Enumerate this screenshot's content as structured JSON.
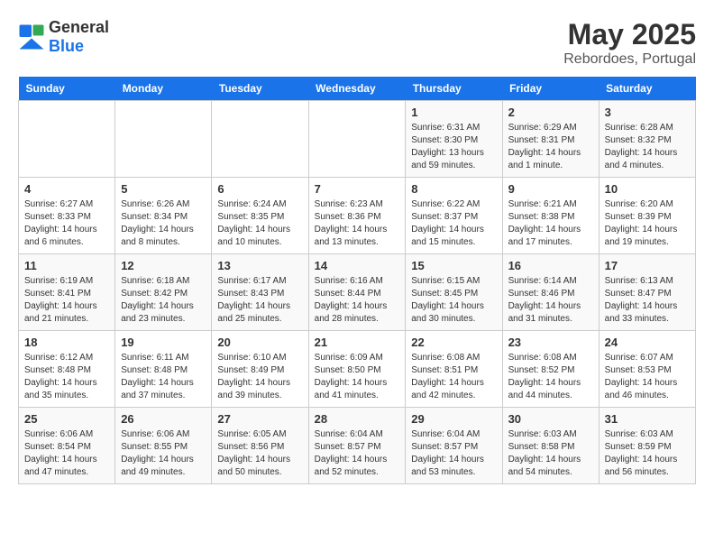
{
  "header": {
    "logo_general": "General",
    "logo_blue": "Blue",
    "main_title": "May 2025",
    "subtitle": "Rebordoes, Portugal"
  },
  "days_of_week": [
    "Sunday",
    "Monday",
    "Tuesday",
    "Wednesday",
    "Thursday",
    "Friday",
    "Saturday"
  ],
  "weeks": [
    [
      {
        "day": "",
        "info": ""
      },
      {
        "day": "",
        "info": ""
      },
      {
        "day": "",
        "info": ""
      },
      {
        "day": "",
        "info": ""
      },
      {
        "day": "1",
        "info": "Sunrise: 6:31 AM\nSunset: 8:30 PM\nDaylight: 13 hours and 59 minutes."
      },
      {
        "day": "2",
        "info": "Sunrise: 6:29 AM\nSunset: 8:31 PM\nDaylight: 14 hours and 1 minute."
      },
      {
        "day": "3",
        "info": "Sunrise: 6:28 AM\nSunset: 8:32 PM\nDaylight: 14 hours and 4 minutes."
      }
    ],
    [
      {
        "day": "4",
        "info": "Sunrise: 6:27 AM\nSunset: 8:33 PM\nDaylight: 14 hours and 6 minutes."
      },
      {
        "day": "5",
        "info": "Sunrise: 6:26 AM\nSunset: 8:34 PM\nDaylight: 14 hours and 8 minutes."
      },
      {
        "day": "6",
        "info": "Sunrise: 6:24 AM\nSunset: 8:35 PM\nDaylight: 14 hours and 10 minutes."
      },
      {
        "day": "7",
        "info": "Sunrise: 6:23 AM\nSunset: 8:36 PM\nDaylight: 14 hours and 13 minutes."
      },
      {
        "day": "8",
        "info": "Sunrise: 6:22 AM\nSunset: 8:37 PM\nDaylight: 14 hours and 15 minutes."
      },
      {
        "day": "9",
        "info": "Sunrise: 6:21 AM\nSunset: 8:38 PM\nDaylight: 14 hours and 17 minutes."
      },
      {
        "day": "10",
        "info": "Sunrise: 6:20 AM\nSunset: 8:39 PM\nDaylight: 14 hours and 19 minutes."
      }
    ],
    [
      {
        "day": "11",
        "info": "Sunrise: 6:19 AM\nSunset: 8:41 PM\nDaylight: 14 hours and 21 minutes."
      },
      {
        "day": "12",
        "info": "Sunrise: 6:18 AM\nSunset: 8:42 PM\nDaylight: 14 hours and 23 minutes."
      },
      {
        "day": "13",
        "info": "Sunrise: 6:17 AM\nSunset: 8:43 PM\nDaylight: 14 hours and 25 minutes."
      },
      {
        "day": "14",
        "info": "Sunrise: 6:16 AM\nSunset: 8:44 PM\nDaylight: 14 hours and 28 minutes."
      },
      {
        "day": "15",
        "info": "Sunrise: 6:15 AM\nSunset: 8:45 PM\nDaylight: 14 hours and 30 minutes."
      },
      {
        "day": "16",
        "info": "Sunrise: 6:14 AM\nSunset: 8:46 PM\nDaylight: 14 hours and 31 minutes."
      },
      {
        "day": "17",
        "info": "Sunrise: 6:13 AM\nSunset: 8:47 PM\nDaylight: 14 hours and 33 minutes."
      }
    ],
    [
      {
        "day": "18",
        "info": "Sunrise: 6:12 AM\nSunset: 8:48 PM\nDaylight: 14 hours and 35 minutes."
      },
      {
        "day": "19",
        "info": "Sunrise: 6:11 AM\nSunset: 8:48 PM\nDaylight: 14 hours and 37 minutes."
      },
      {
        "day": "20",
        "info": "Sunrise: 6:10 AM\nSunset: 8:49 PM\nDaylight: 14 hours and 39 minutes."
      },
      {
        "day": "21",
        "info": "Sunrise: 6:09 AM\nSunset: 8:50 PM\nDaylight: 14 hours and 41 minutes."
      },
      {
        "day": "22",
        "info": "Sunrise: 6:08 AM\nSunset: 8:51 PM\nDaylight: 14 hours and 42 minutes."
      },
      {
        "day": "23",
        "info": "Sunrise: 6:08 AM\nSunset: 8:52 PM\nDaylight: 14 hours and 44 minutes."
      },
      {
        "day": "24",
        "info": "Sunrise: 6:07 AM\nSunset: 8:53 PM\nDaylight: 14 hours and 46 minutes."
      }
    ],
    [
      {
        "day": "25",
        "info": "Sunrise: 6:06 AM\nSunset: 8:54 PM\nDaylight: 14 hours and 47 minutes."
      },
      {
        "day": "26",
        "info": "Sunrise: 6:06 AM\nSunset: 8:55 PM\nDaylight: 14 hours and 49 minutes."
      },
      {
        "day": "27",
        "info": "Sunrise: 6:05 AM\nSunset: 8:56 PM\nDaylight: 14 hours and 50 minutes."
      },
      {
        "day": "28",
        "info": "Sunrise: 6:04 AM\nSunset: 8:57 PM\nDaylight: 14 hours and 52 minutes."
      },
      {
        "day": "29",
        "info": "Sunrise: 6:04 AM\nSunset: 8:57 PM\nDaylight: 14 hours and 53 minutes."
      },
      {
        "day": "30",
        "info": "Sunrise: 6:03 AM\nSunset: 8:58 PM\nDaylight: 14 hours and 54 minutes."
      },
      {
        "day": "31",
        "info": "Sunrise: 6:03 AM\nSunset: 8:59 PM\nDaylight: 14 hours and 56 minutes."
      }
    ]
  ]
}
